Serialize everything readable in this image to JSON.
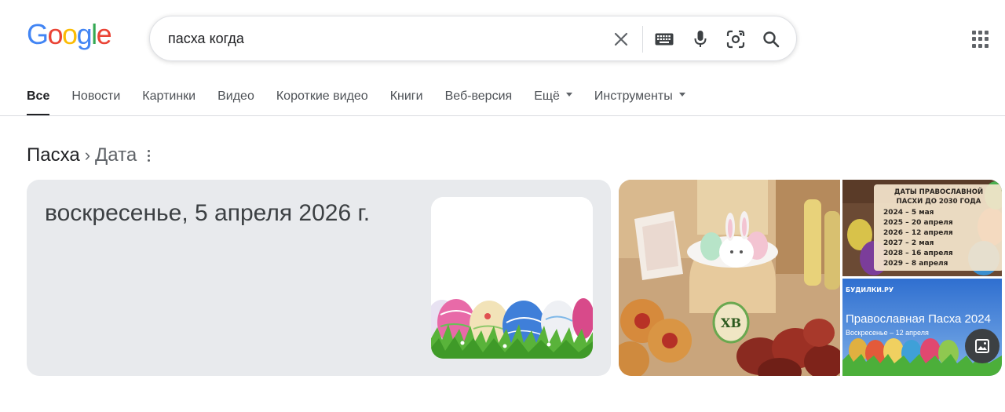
{
  "logo": {
    "letters": [
      "G",
      "o",
      "o",
      "g",
      "l",
      "e"
    ],
    "colors": [
      "#4285F4",
      "#EA4335",
      "#FBBC05",
      "#4285F4",
      "#34A853",
      "#EA4335"
    ]
  },
  "search": {
    "query": "пасха когда"
  },
  "icons": {
    "clear": "close-icon",
    "keyboard": "keyboard-icon",
    "voice": "mic-icon",
    "lens": "lens-icon",
    "search": "search-icon",
    "apps": "apps-grid-icon"
  },
  "tabs": [
    {
      "label": "Все",
      "active": true
    },
    {
      "label": "Новости"
    },
    {
      "label": "Картинки"
    },
    {
      "label": "Видео"
    },
    {
      "label": "Короткие видео"
    },
    {
      "label": "Книги"
    },
    {
      "label": "Веб-версия"
    },
    {
      "label": "Ещё",
      "dropdown": true
    },
    {
      "label": "Инструменты",
      "dropdown": true
    }
  ],
  "breadcrumb": {
    "root": "Пасха",
    "separator": "›",
    "current": "Дата"
  },
  "answer": {
    "text": "воскресенье, 5 апреля 2026 г."
  },
  "gallery": {
    "main_badge": "ХВ",
    "dates_card": {
      "title_line1": "ДАТЫ ПРАВОСЛАВНОЙ",
      "title_line2": "ПАСХИ ДО 2030 ГОДА",
      "items": [
        "2024 – 5 мая",
        "2025 – 20 апреля",
        "2026 – 12 апреля",
        "2027 – 2 мая",
        "2028 – 16 апреля",
        "2029 – 8 апреля"
      ]
    },
    "promo": {
      "brand": "БУДИЛКИ.РУ",
      "title": "Православная Пасха 2024",
      "subtitle": "Воскресенье – 12 апреля"
    }
  },
  "colors": {
    "accent": "#202124",
    "card_bg": "#e8eaed",
    "muted": "#5f6368"
  }
}
